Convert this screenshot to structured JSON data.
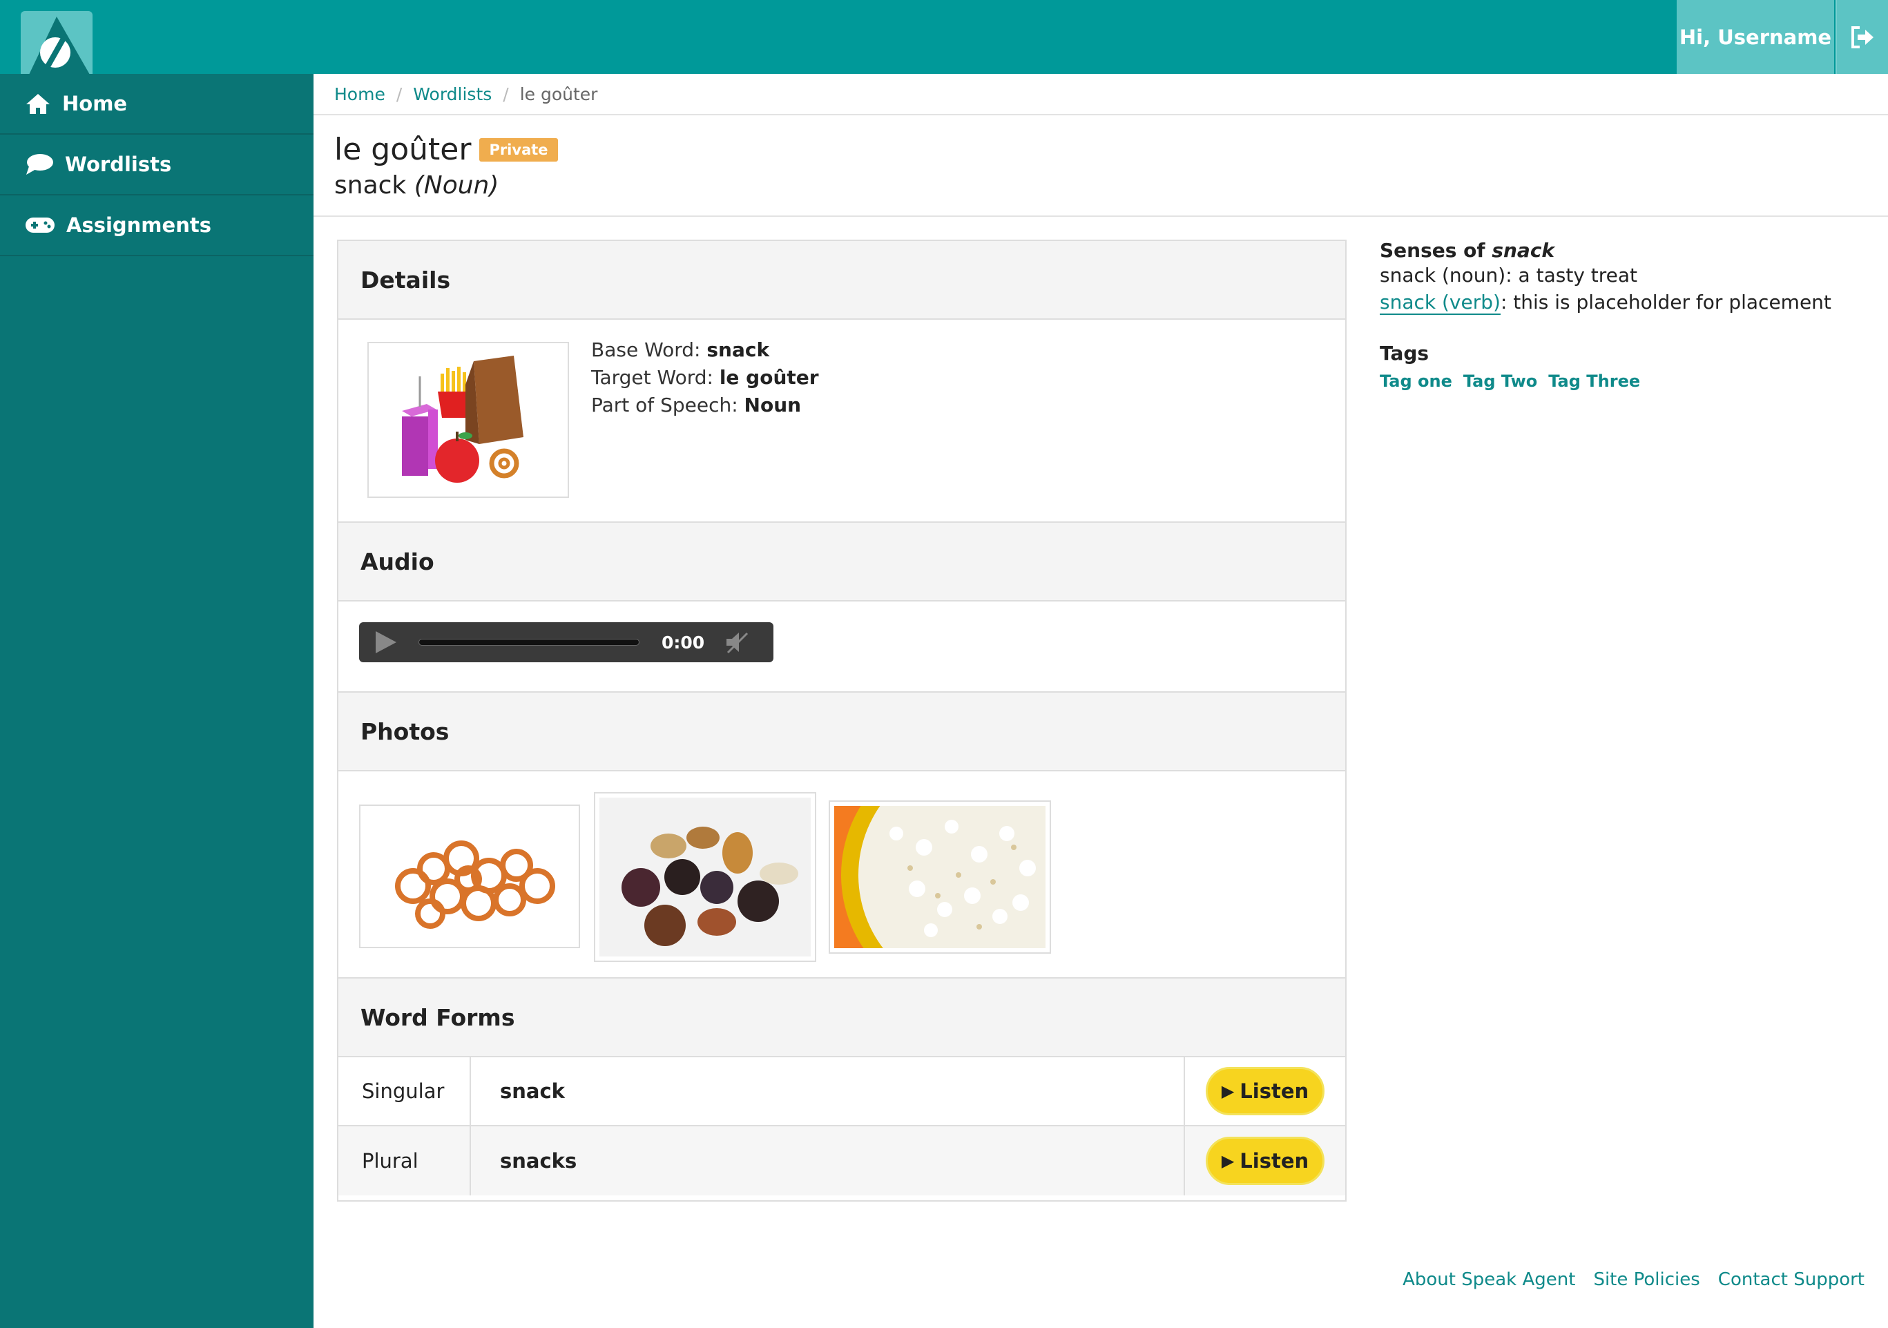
{
  "header": {
    "greeting": "Hi, Username"
  },
  "sidebar": {
    "items": [
      {
        "label": "Home",
        "icon": "home-icon"
      },
      {
        "label": "Wordlists",
        "icon": "speech-bubble-icon"
      },
      {
        "label": "Assignments",
        "icon": "gamepad-icon"
      }
    ]
  },
  "breadcrumb": {
    "home": "Home",
    "wordlists": "Wordlists",
    "current": "le goûter"
  },
  "page": {
    "title": "le goûter",
    "badge": "Private",
    "subtitle_word": "snack",
    "subtitle_pos": "(Noun)"
  },
  "details": {
    "heading": "Details",
    "base_word_label": "Base Word: ",
    "base_word": "snack",
    "target_word_label": "Target Word: ",
    "target_word": "le goûter",
    "pos_label": "Part of Speech: ",
    "pos": "Noun"
  },
  "audio": {
    "heading": "Audio",
    "time": "0:00"
  },
  "photos": {
    "heading": "Photos"
  },
  "word_forms": {
    "heading": "Word Forms",
    "rows": [
      {
        "label": "Singular",
        "value": "snack",
        "button": "Listen"
      },
      {
        "label": "Plural",
        "value": "snacks",
        "button": "Listen"
      }
    ]
  },
  "senses": {
    "heading_prefix": "Senses of ",
    "heading_word": "snack",
    "items": [
      {
        "term": "snack (noun)",
        "definition": ": a tasty treat"
      },
      {
        "term": "snack (verb)",
        "definition": ": this is placeholder for placement"
      }
    ]
  },
  "tags": {
    "heading": "Tags",
    "items": [
      "Tag one",
      "Tag Two",
      "Tag Three"
    ]
  },
  "footer": {
    "about": "About Speak Agent",
    "policies": "Site Policies",
    "support": "Contact Support"
  },
  "colors": {
    "topbar": "#009999",
    "sidebar": "#0a7575",
    "accent_link": "#0f8a8a",
    "badge": "#f0ad4e",
    "listen_button": "#f7d41f"
  }
}
